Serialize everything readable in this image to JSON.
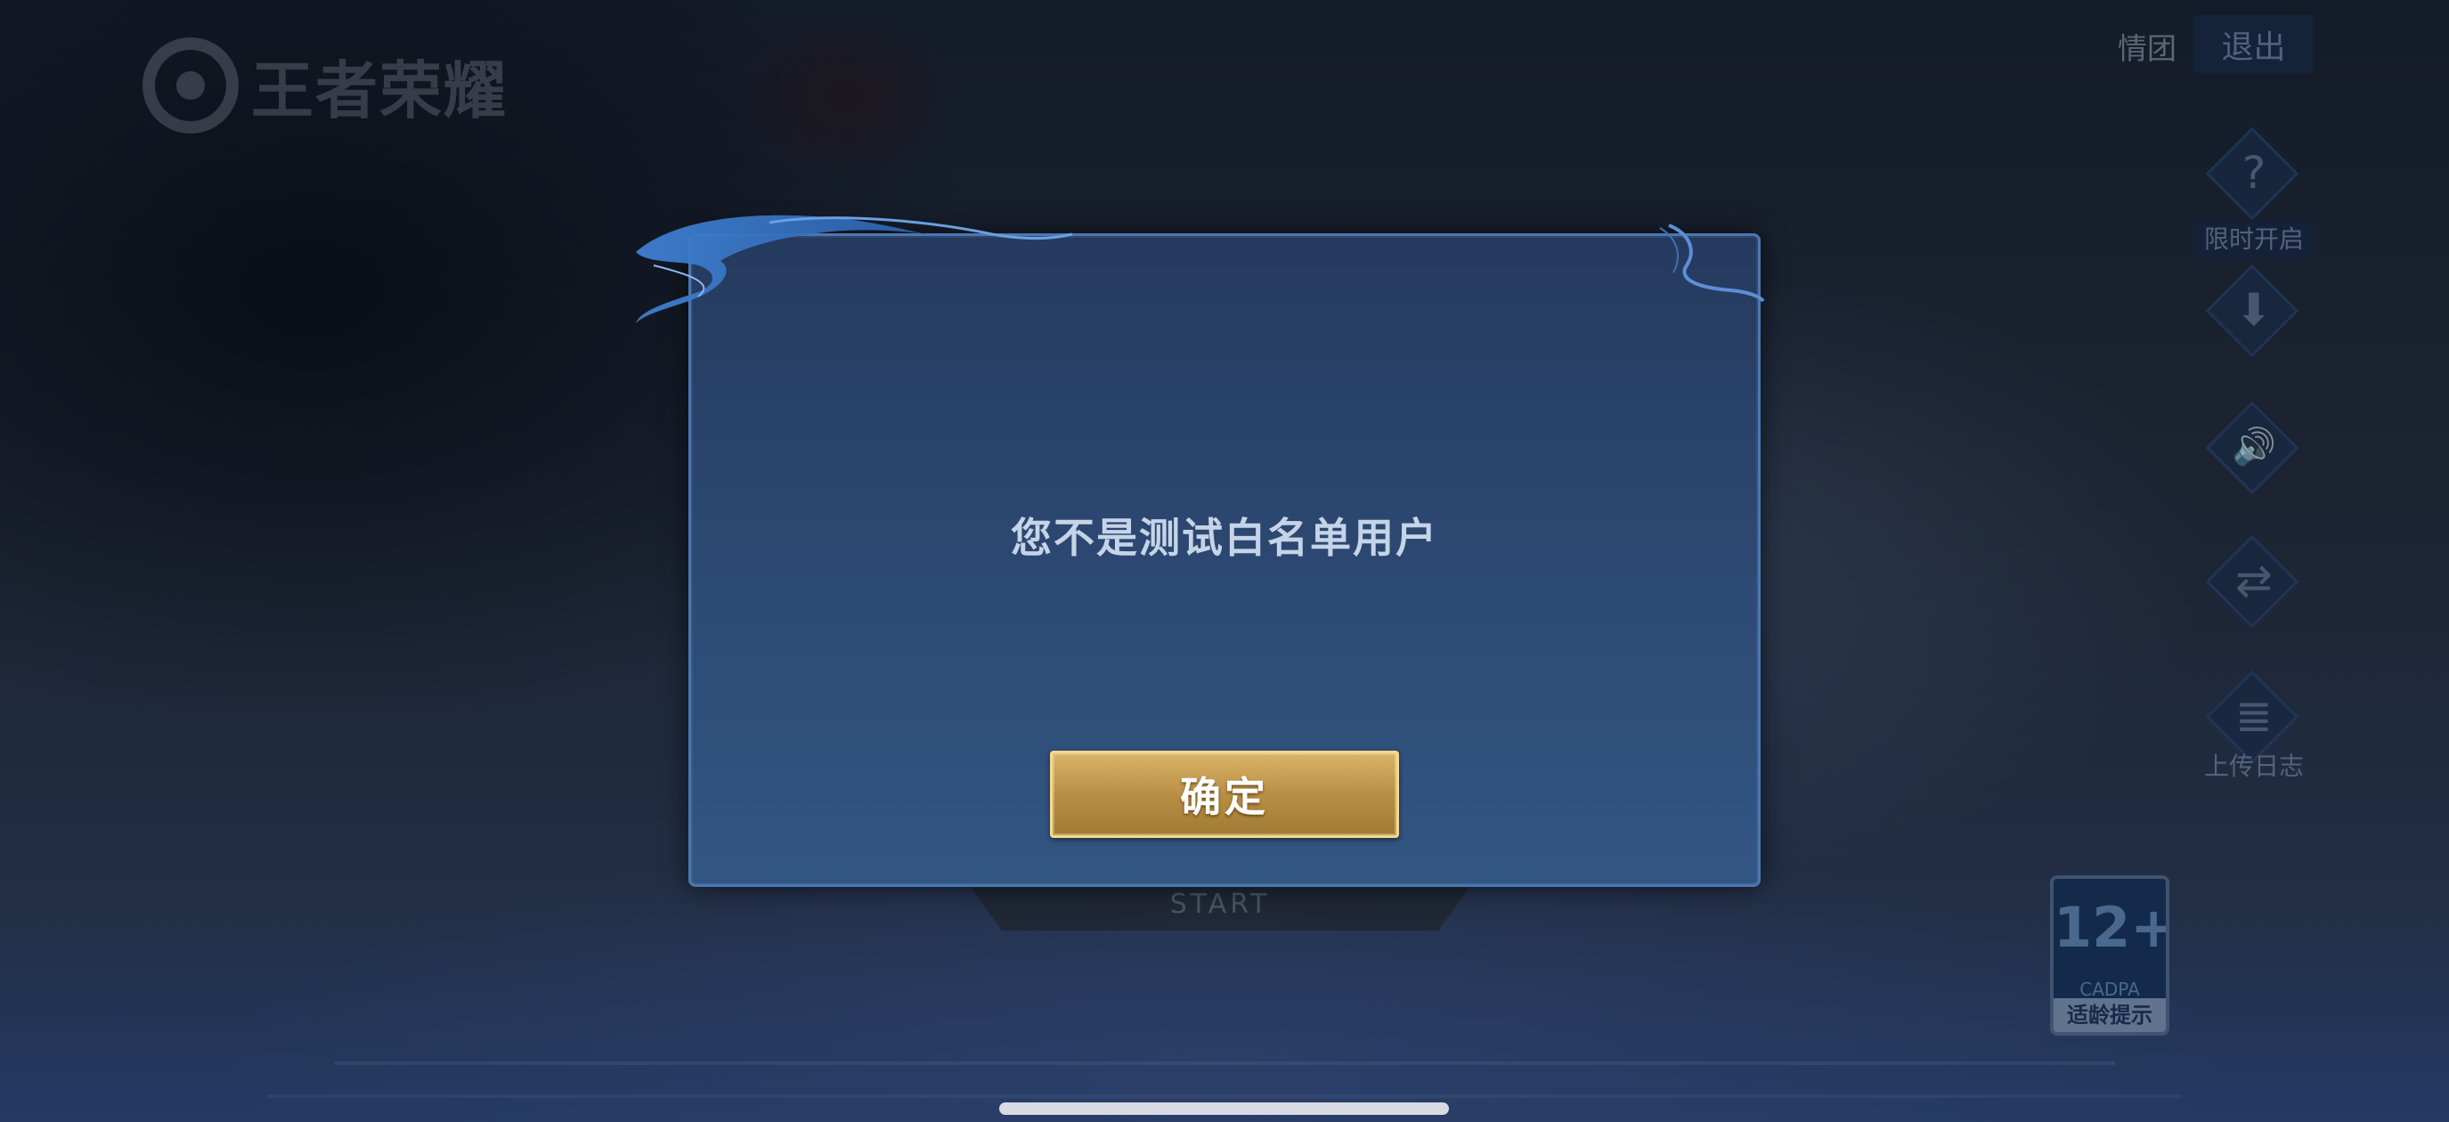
{
  "app": {
    "logo_text": "王者荣耀"
  },
  "header": {
    "qingtuan_label": "情团",
    "exit_label": "退出"
  },
  "side_menu": {
    "items": [
      {
        "label": "限时开启",
        "icon": "question-icon",
        "glyph": "?"
      },
      {
        "label": "",
        "icon": "download-icon",
        "glyph": "⬇"
      },
      {
        "label": "",
        "icon": "volume-icon",
        "glyph": "🔊"
      },
      {
        "label": "",
        "icon": "switch-icon",
        "glyph": "⇄"
      },
      {
        "label": "上传日志",
        "icon": "upload-log-icon",
        "glyph": "≣"
      }
    ]
  },
  "age_rating": {
    "age": "12+",
    "org": "CADPA",
    "tip": "适龄提示"
  },
  "start_button": {
    "label": "START"
  },
  "dialog": {
    "message": "您不是测试白名单用户",
    "confirm_label": "确定"
  },
  "colors": {
    "dialog_border": "#4d77b0",
    "dialog_bg": "#2d4a74",
    "button_gold": "#c9a155",
    "button_border": "#f3d98a"
  }
}
